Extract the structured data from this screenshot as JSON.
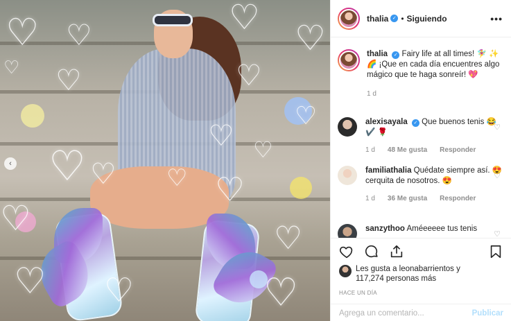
{
  "colors": {
    "accent": "#3897f0",
    "text": "#262626",
    "muted": "#8e8e8e",
    "publish_disabled": "#b2dffc"
  },
  "header": {
    "username": "thalia",
    "separator": "•",
    "follow_status": "Siguiendo",
    "more_icon": "ellipsis-icon",
    "more_label": "•••"
  },
  "caption": {
    "username": "thalia",
    "text": "Fairy life at all times! 🧚‍♀️ ✨ 🌈 ¡Que en cada día encuentres algo mágico que te haga sonreír! 💖",
    "time": "1 d"
  },
  "comments": [
    {
      "username": "alexisayala",
      "verified": true,
      "text": "Que buenos tenis 😂 ✔️ 🌹",
      "time": "1 d",
      "likes": "48 Me gusta",
      "reply": "Responder"
    },
    {
      "username": "familiathalia",
      "verified": false,
      "text": "Quédate siempre así. 😍 cerquita de nosotros. 😍",
      "time": "1 d",
      "likes": "36 Me gusta",
      "reply": "Responder"
    },
    {
      "username": "sanzythoo",
      "verified": false,
      "text": "Améeeeee tus tenis"
    }
  ],
  "actions": {
    "like_icon": "heart-icon",
    "comment_icon": "comment-icon",
    "share_icon": "share-icon",
    "save_icon": "bookmark-icon"
  },
  "likes": {
    "line1": "Les gusta a leonabarrientos y",
    "line2": "117,274 personas más"
  },
  "timestamp": "HACE UN DÍA",
  "add_comment": {
    "placeholder": "Agrega un comentario...",
    "publish": "Publicar"
  },
  "glyphs": {
    "heart": "♡",
    "verified": "✓",
    "prev": "‹"
  }
}
